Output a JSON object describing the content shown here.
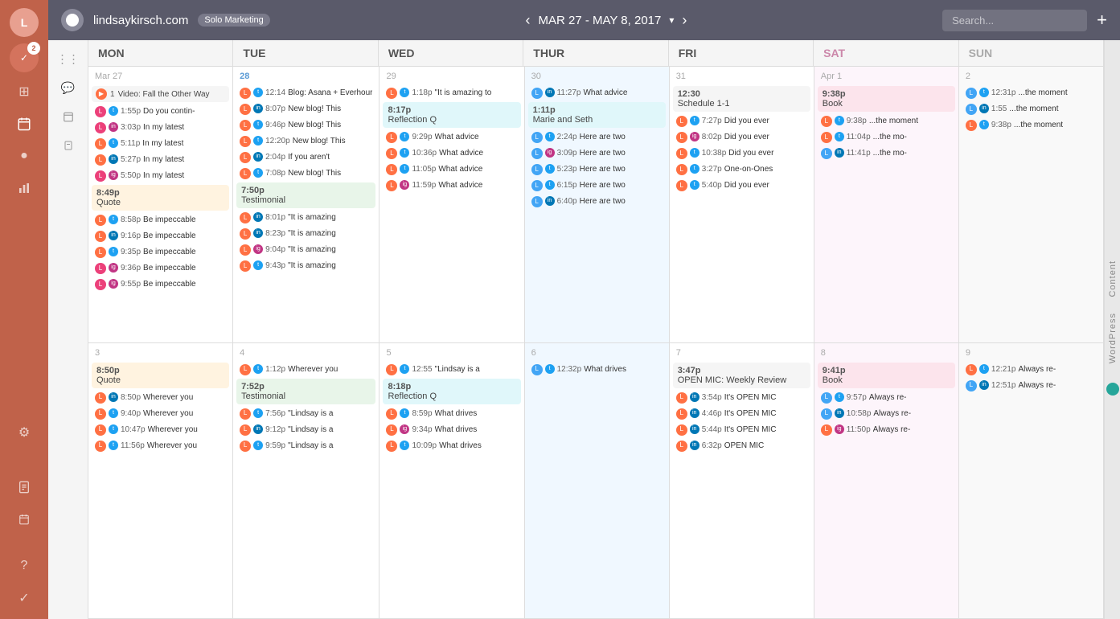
{
  "topbar": {
    "site": "lindsaykirsch.com",
    "tag": "Solo Marketing",
    "date_range": "MAR 27 - MAY 8, 2017",
    "search_placeholder": "Search..."
  },
  "days": [
    "MON",
    "TUE",
    "WED",
    "THUR",
    "FRI",
    "SAT",
    "SUN"
  ],
  "week1": {
    "mon": {
      "num": "Mar 27",
      "items": [
        {
          "time": "1:55p",
          "text": "Do you contin-",
          "avatars": [
            "orange",
            "twitter"
          ]
        },
        {
          "time": "3:03p",
          "text": "In my latest",
          "avatars": [
            "pink",
            "orange"
          ]
        },
        {
          "time": "5:11p",
          "text": "In my latest",
          "avatars": [
            "orange",
            "twitter"
          ]
        },
        {
          "time": "5:27p",
          "text": "In my latest",
          "avatars": [
            "orange",
            "linkedin"
          ]
        },
        {
          "time": "5:50p",
          "text": "In my latest",
          "avatars": [
            "pink",
            "orange"
          ]
        },
        {
          "time": "8:49p",
          "block": true,
          "blockTitle": "Quote",
          "blockBg": "bg-orange"
        },
        {
          "time": "8:58p",
          "text": "Be impeccable",
          "avatars": [
            "orange",
            "twitter"
          ]
        },
        {
          "time": "9:16p",
          "text": "Be impeccable",
          "avatars": [
            "orange",
            "linkedin"
          ]
        },
        {
          "time": "9:35p",
          "text": "Be impeccable",
          "avatars": [
            "orange",
            "twitter"
          ]
        },
        {
          "time": "9:36p",
          "text": "Be impeccable",
          "avatars": [
            "pink",
            "orange"
          ]
        },
        {
          "time": "9:55p",
          "text": "Be impeccable",
          "avatars": [
            "pink",
            "orange"
          ]
        }
      ],
      "special": {
        "time": "1",
        "title": "Video: Fall the Other Way",
        "bg": "bg-gray"
      }
    },
    "tue": {
      "num": "28",
      "numBlue": true,
      "items": [
        {
          "time": "12:14",
          "text": "Blog: Asana + Everhour",
          "avatars": [
            "orange",
            "twitter"
          ]
        },
        {
          "time": "8:07p",
          "text": "New blog! This",
          "avatars": [
            "orange",
            "linkedin"
          ]
        },
        {
          "time": "9:46p",
          "text": "New blog! This",
          "avatars": [
            "orange",
            "twitter"
          ]
        },
        {
          "time": "12:20p",
          "text": "New blog! This",
          "avatars": [
            "orange",
            "twitter"
          ]
        },
        {
          "time": "2:04p",
          "text": "If you aren't",
          "avatars": [
            "orange",
            "linkedin"
          ]
        },
        {
          "time": "7:08p",
          "text": "New blog! This",
          "avatars": [
            "orange",
            "twitter"
          ]
        },
        {
          "time": "7:50p",
          "block": true,
          "blockTitle": "Testimonial",
          "blockBg": "bg-green"
        },
        {
          "time": "8:01p",
          "text": "\"It is amazing",
          "avatars": [
            "orange",
            "linkedin"
          ]
        },
        {
          "time": "8:23p",
          "text": "\"It is amazing",
          "avatars": [
            "orange",
            "linkedin"
          ]
        },
        {
          "time": "9:04p",
          "text": "\"It is amazing",
          "avatars": [
            "orange",
            "instagram"
          ]
        },
        {
          "time": "9:43p",
          "text": "\"It is amazing",
          "avatars": [
            "orange",
            "twitter"
          ]
        },
        {
          "time": "",
          "text": "",
          "avatars": []
        }
      ]
    },
    "wed": {
      "num": "29",
      "items": [
        {
          "time": "1:18p",
          "text": "\"It is amazing to",
          "avatars": [
            "orange",
            "twitter"
          ]
        },
        {
          "time": "8:17p",
          "block": true,
          "blockTitle": "Reflection Q",
          "blockBg": "bg-teal"
        },
        {
          "time": "9:29p",
          "text": "What advice",
          "avatars": [
            "orange",
            "twitter"
          ]
        },
        {
          "time": "10:36p",
          "text": "What advice",
          "avatars": [
            "orange",
            "twitter"
          ]
        },
        {
          "time": "11:05p",
          "text": "What advice",
          "avatars": [
            "orange",
            "twitter"
          ]
        },
        {
          "time": "11:59p",
          "text": "What advice",
          "avatars": [
            "orange",
            "instagram"
          ]
        }
      ]
    },
    "thu": {
      "num": "30",
      "items": [
        {
          "time": "11:27p",
          "text": "What advice",
          "avatars": [
            "blue",
            "linkedin"
          ]
        },
        {
          "time": "1:11p",
          "block": true,
          "blockTitle": "Marie and Seth",
          "blockBg": "bg-teal"
        },
        {
          "time": "2:24p",
          "text": "Here are two",
          "avatars": [
            "blue",
            "twitter"
          ]
        },
        {
          "time": "3:09p",
          "text": "Here are two",
          "avatars": [
            "blue",
            "instagram"
          ]
        },
        {
          "time": "5:23p",
          "text": "Here are two",
          "avatars": [
            "blue",
            "twitter"
          ]
        },
        {
          "time": "6:15p",
          "text": "Here are two",
          "avatars": [
            "blue",
            "twitter"
          ]
        },
        {
          "time": "6:40p",
          "text": "Here are two",
          "avatars": [
            "blue",
            "linkedin"
          ]
        }
      ]
    },
    "fri": {
      "num": "31",
      "items": [
        {
          "time": "12:30",
          "block": true,
          "blockTitle": "Schedule 1-1",
          "blockBg": "bg-gray"
        },
        {
          "time": "7:27p",
          "text": "Did you ever",
          "avatars": [
            "orange",
            "twitter"
          ]
        },
        {
          "time": "8:02p",
          "text": "Did you ever",
          "avatars": [
            "orange",
            "instagram"
          ]
        },
        {
          "time": "10:38p",
          "text": "Did you ever",
          "avatars": [
            "orange",
            "twitter"
          ]
        },
        {
          "time": "3:27p",
          "text": "One-on-Ones",
          "avatars": [
            "orange",
            "twitter"
          ]
        },
        {
          "time": "5:40p",
          "text": "Did you ever",
          "avatars": [
            "orange",
            "twitter"
          ]
        }
      ]
    },
    "sat": {
      "num": "Apr 1",
      "items": [
        {
          "time": "9:38p",
          "block": true,
          "blockTitle": "Book",
          "blockBg": "bg-pink"
        },
        {
          "time": "9:38p",
          "text": "...the moment",
          "avatars": [
            "orange",
            "twitter"
          ]
        },
        {
          "time": "11:04p",
          "text": "...the mo-",
          "avatars": [
            "orange",
            "twitter"
          ]
        },
        {
          "time": "11:41p",
          "text": "...the mo-",
          "avatars": [
            "blue",
            "orange"
          ]
        }
      ]
    },
    "sun": {
      "num": "2",
      "items": [
        {
          "time": "12:31p",
          "text": "...the moment",
          "avatars": [
            "blue",
            "twitter"
          ]
        },
        {
          "time": "1:55",
          "text": "...the moment",
          "avatars": [
            "blue",
            "linkedin"
          ]
        },
        {
          "time": "9:38p",
          "text": "...the moment",
          "avatars": [
            "orange",
            "twitter"
          ]
        }
      ]
    }
  },
  "week2": {
    "mon": {
      "num": "3",
      "items": [
        {
          "time": "8:50p",
          "block": true,
          "blockTitle": "Quote",
          "blockBg": "bg-orange"
        },
        {
          "time": "8:50p",
          "text": "Wherever you",
          "avatars": [
            "orange",
            "linkedin"
          ]
        },
        {
          "time": "9:40p",
          "text": "Wherever you",
          "avatars": [
            "orange",
            "twitter"
          ]
        },
        {
          "time": "10:47p",
          "text": "Wherever you",
          "avatars": [
            "orange",
            "twitter"
          ]
        },
        {
          "time": "11:56p",
          "text": "Wherever you",
          "avatars": [
            "orange",
            "twitter"
          ]
        }
      ]
    },
    "tue": {
      "num": "4",
      "items": [
        {
          "time": "1:12p",
          "text": "Wherever you",
          "avatars": [
            "orange",
            "twitter"
          ]
        },
        {
          "time": "7:52p",
          "block": true,
          "blockTitle": "Testimonial",
          "blockBg": "bg-green"
        },
        {
          "time": "7:56p",
          "text": "\"Lindsay is a",
          "avatars": [
            "orange",
            "twitter"
          ]
        },
        {
          "time": "9:12p",
          "text": "\"Lindsay is a",
          "avatars": [
            "orange",
            "linkedin"
          ]
        },
        {
          "time": "9:59p",
          "text": "\"Lindsay is a",
          "avatars": [
            "orange",
            "twitter"
          ]
        }
      ]
    },
    "wed": {
      "num": "5",
      "items": [
        {
          "time": "12:55",
          "text": "\"Lindsay is a",
          "avatars": [
            "orange",
            "twitter"
          ]
        },
        {
          "time": "8:18p",
          "block": true,
          "blockTitle": "Reflection Q",
          "blockBg": "bg-teal"
        },
        {
          "time": "8:59p",
          "text": "What drives",
          "avatars": [
            "orange",
            "twitter"
          ]
        },
        {
          "time": "9:34p",
          "text": "What drives",
          "avatars": [
            "orange",
            "instagram"
          ]
        },
        {
          "time": "10:09p",
          "text": "What drives",
          "avatars": [
            "orange",
            "twitter"
          ]
        }
      ]
    },
    "thu": {
      "num": "6",
      "items": [
        {
          "time": "12:32p",
          "text": "What drives",
          "avatars": [
            "blue",
            "twitter"
          ]
        }
      ]
    },
    "fri": {
      "num": "7",
      "items": [
        {
          "time": "3:47p",
          "block": true,
          "blockTitle": "OPEN MIC: Weekly Review",
          "blockBg": "bg-gray"
        },
        {
          "time": "3:54p",
          "text": "It's OPEN MIC",
          "avatars": [
            "orange",
            "linkedin"
          ]
        },
        {
          "time": "4:46p",
          "text": "It's OPEN MIC",
          "avatars": [
            "orange",
            "linkedin"
          ]
        },
        {
          "time": "5:44p",
          "text": "It's OPEN MIC",
          "avatars": [
            "orange",
            "linkedin"
          ]
        },
        {
          "time": "6:32p",
          "text": "OPEN MIC",
          "avatars": [
            "orange",
            "linkedin"
          ]
        }
      ]
    },
    "sat": {
      "num": "8",
      "items": [
        {
          "time": "9:41p",
          "block": true,
          "blockTitle": "Book",
          "blockBg": "bg-pink"
        },
        {
          "time": "9:57p",
          "text": "Always re-",
          "avatars": [
            "blue",
            "twitter"
          ]
        },
        {
          "time": "10:58p",
          "text": "Always re-",
          "avatars": [
            "blue",
            "linkedin"
          ]
        },
        {
          "time": "11:50p",
          "text": "Always re-",
          "avatars": [
            "orange",
            "instagram"
          ]
        }
      ]
    },
    "sun": {
      "num": "9",
      "items": [
        {
          "time": "12:21p",
          "text": "Always re-",
          "avatars": [
            "orange",
            "twitter"
          ]
        },
        {
          "time": "12:51p",
          "text": "Always re-",
          "avatars": [
            "blue",
            "orange"
          ]
        }
      ]
    }
  }
}
